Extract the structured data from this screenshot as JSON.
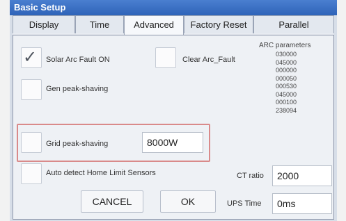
{
  "window": {
    "title": "Basic Setup"
  },
  "tabs": [
    {
      "label": "Display"
    },
    {
      "label": "Time"
    },
    {
      "label": "Advanced"
    },
    {
      "label": "Factory Reset"
    },
    {
      "label": "Parallel"
    }
  ],
  "settings": {
    "solar_arc_fault": {
      "label": "Solar Arc Fault ON",
      "checked": true
    },
    "clear_arc_fault": {
      "label": "Clear Arc_Fault"
    },
    "gen_peak_shaving": {
      "label": "Gen peak-shaving",
      "checked": false
    },
    "grid_peak_shaving": {
      "label": "Grid peak-shaving",
      "value": "8000W",
      "checked": false
    },
    "auto_detect": {
      "label": "Auto detect Home Limit Sensors",
      "checked": false
    },
    "ct_ratio": {
      "label": "CT ratio",
      "value": "2000"
    },
    "ups_time": {
      "label": "UPS Time",
      "value": "0ms"
    }
  },
  "arc_parameters": {
    "title": "ARC parameters",
    "values": [
      "030000",
      "045000",
      "000000",
      "000050",
      "000530",
      "045000",
      "000100",
      "238094"
    ]
  },
  "buttons": {
    "cancel": "CANCEL",
    "ok": "OK"
  },
  "colors": {
    "title_bar": "#2e63b8",
    "panel": "#eef1f5",
    "highlight": "#d98a8a"
  }
}
